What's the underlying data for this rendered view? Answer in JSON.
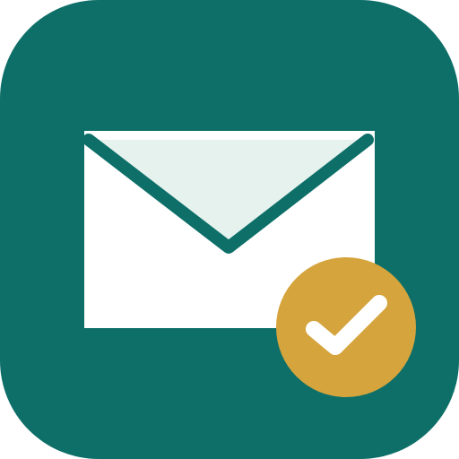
{
  "icon": {
    "name": "mail-verified-app-icon",
    "badge": "checkmark",
    "colors": {
      "tile": "#0d6f68",
      "envelope": "#ffffff",
      "flap": "#e6f2ee",
      "envelope_stroke": "#0d6f68",
      "badge": "#d5a43d",
      "check": "#ffffff"
    }
  }
}
